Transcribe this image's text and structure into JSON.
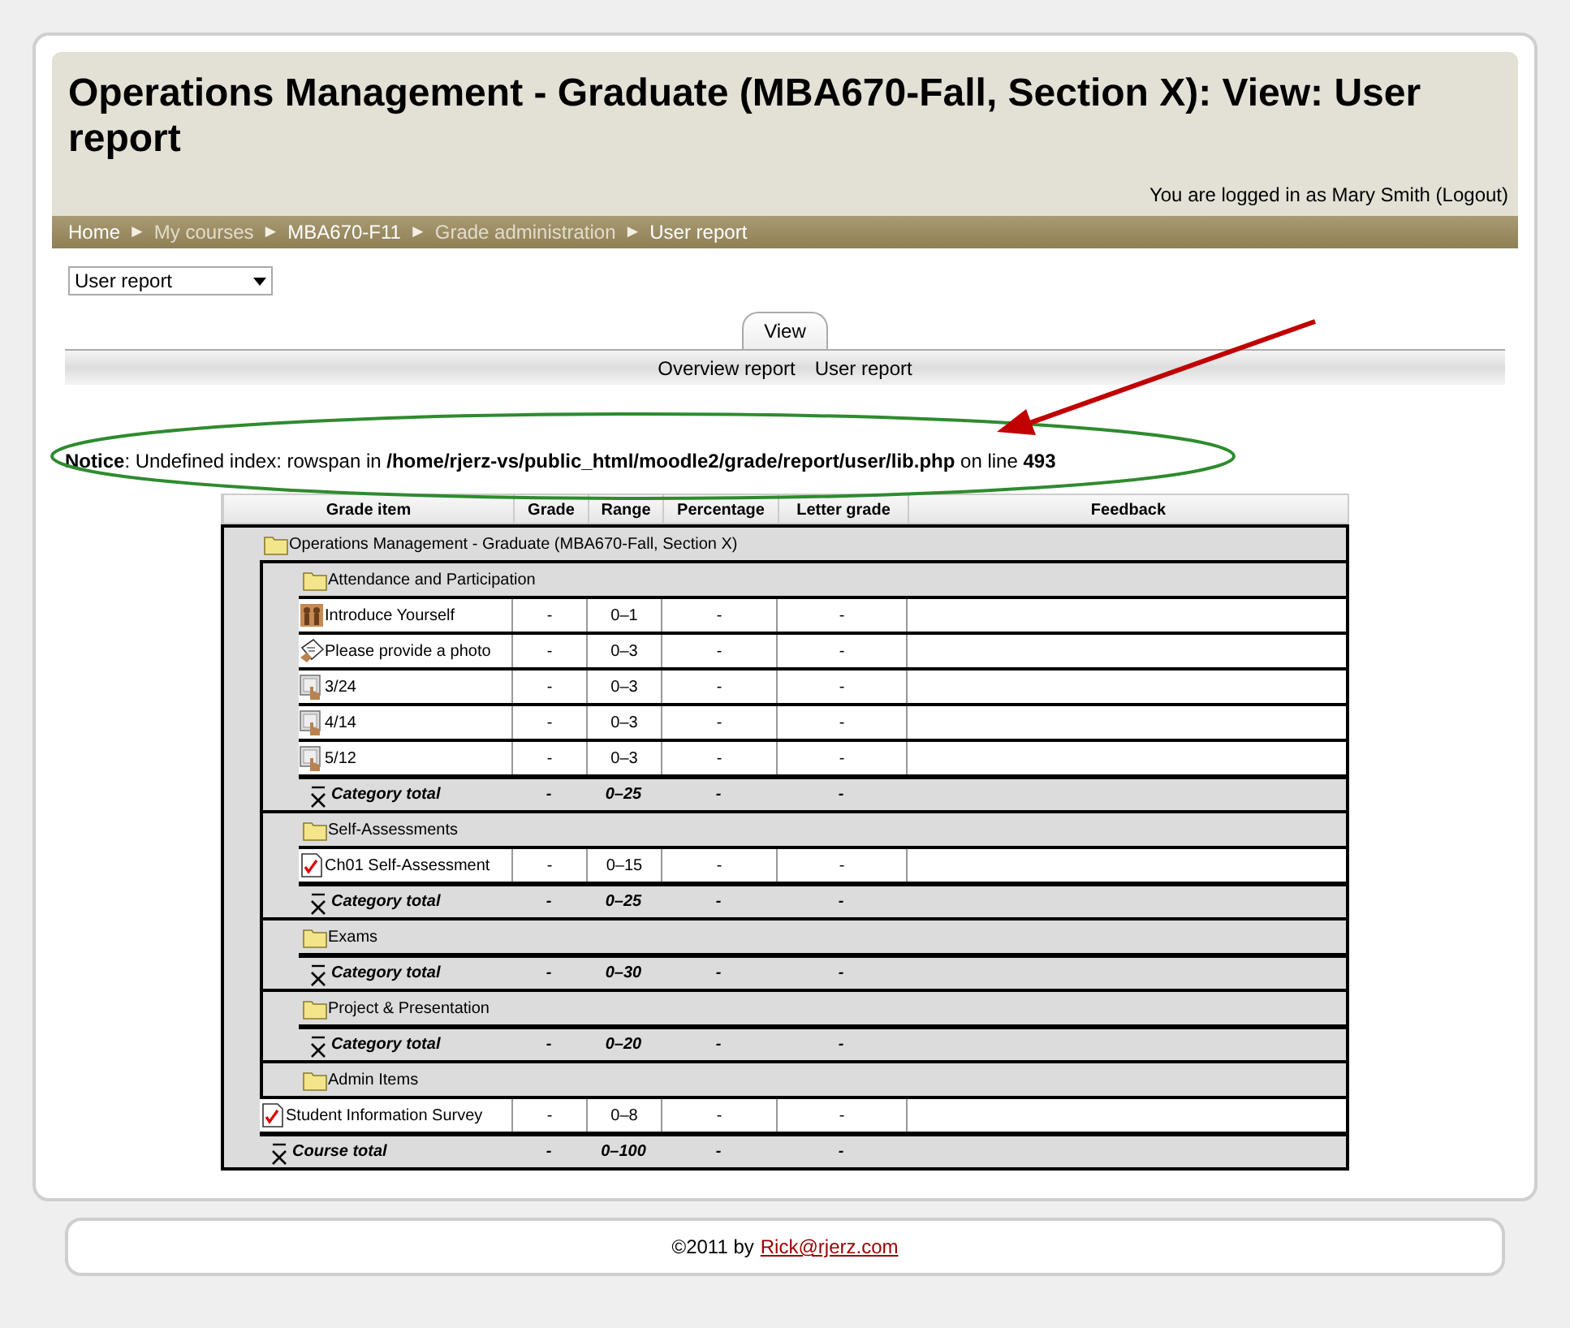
{
  "header": {
    "title": "Operations Management - Graduate (MBA670-Fall, Section X): View: User report",
    "login_info": "You are logged in as Mary Smith (Logout)"
  },
  "breadcrumb": {
    "separator": "►",
    "items": [
      {
        "label": "Home",
        "dimmed": false
      },
      {
        "label": "My courses",
        "dimmed": true
      },
      {
        "label": "MBA670-F11",
        "dimmed": false
      },
      {
        "label": "Grade administration",
        "dimmed": true
      },
      {
        "label": "User report",
        "dimmed": false
      }
    ]
  },
  "report_select": {
    "value": "User report"
  },
  "tabs": [
    {
      "label": "View",
      "selected": true
    }
  ],
  "subtabs": [
    {
      "label": "Overview report"
    },
    {
      "label": "User report"
    }
  ],
  "notice": "**Notice**: Undefined index: rowspan in **/home/rjerz-vs/public_html/moodle2/grade/report/user/lib.php** on line **493**",
  "grade_table": {
    "columns": [
      "Grade item",
      "Grade",
      "Range",
      "Percentage",
      "Letter grade",
      "Feedback"
    ],
    "rows": [
      {
        "kind": "category",
        "name": "Operations Management - Graduate (MBA670-Fall, Section X)",
        "children": [
          {
            "kind": "category",
            "name": "Attendance and Participation",
            "children": [
              {
                "kind": "forum",
                "name": "Introduce Yourself",
                "grade": "-",
                "range": "0–1",
                "percentage": "-",
                "letter": "-"
              },
              {
                "kind": "assignment",
                "name": "Please provide a photo",
                "grade": "-",
                "range": "0–3",
                "percentage": "-",
                "letter": "-"
              },
              {
                "kind": "choice",
                "name": "3/24",
                "grade": "-",
                "range": "0–3",
                "percentage": "-",
                "letter": "-"
              },
              {
                "kind": "choice",
                "name": "4/14",
                "grade": "-",
                "range": "0–3",
                "percentage": "-",
                "letter": "-"
              },
              {
                "kind": "choice",
                "name": "5/12",
                "grade": "-",
                "range": "0–3",
                "percentage": "-",
                "letter": "-"
              },
              {
                "kind": "total",
                "name": "Category total",
                "grade": "-",
                "range": "0–25",
                "percentage": "-",
                "letter": "-"
              }
            ]
          },
          {
            "kind": "category",
            "name": "Self-Assessments",
            "children": [
              {
                "kind": "quiz",
                "name": "Ch01 Self-Assessment",
                "grade": "-",
                "range": "0–15",
                "percentage": "-",
                "letter": "-"
              },
              {
                "kind": "total",
                "name": "Category total",
                "grade": "-",
                "range": "0–25",
                "percentage": "-",
                "letter": "-"
              }
            ]
          },
          {
            "kind": "category",
            "name": "Exams",
            "children": [
              {
                "kind": "total",
                "name": "Category total",
                "grade": "-",
                "range": "0–30",
                "percentage": "-",
                "letter": "-"
              }
            ]
          },
          {
            "kind": "category",
            "name": "Project & Presentation",
            "children": [
              {
                "kind": "total",
                "name": "Category total",
                "grade": "-",
                "range": "0–20",
                "percentage": "-",
                "letter": "-"
              }
            ]
          },
          {
            "kind": "category",
            "name": "Admin Items"
          },
          {
            "kind": "quiz",
            "name": "Student Information Survey",
            "grade": "-",
            "range": "0–8",
            "percentage": "-",
            "letter": "-"
          },
          {
            "kind": "total",
            "name": "Course total",
            "grade": "-",
            "range": "0–100",
            "percentage": "-",
            "letter": "-"
          }
        ]
      }
    ]
  },
  "footer": {
    "text": "©2011 by",
    "link": "Rick@rjerz.com"
  }
}
